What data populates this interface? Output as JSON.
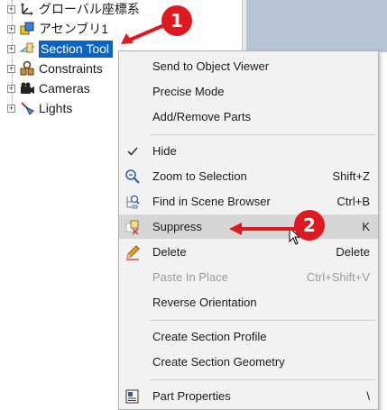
{
  "tree": {
    "items": [
      {
        "label": "グローバル座標系",
        "icon": "coordinate-system-icon"
      },
      {
        "label": "アセンブリ1",
        "icon": "assembly-icon"
      },
      {
        "label": "Section Tool",
        "icon": "section-tool-icon",
        "selected": true
      },
      {
        "label": "Constraints",
        "icon": "constraints-icon"
      },
      {
        "label": "Cameras",
        "icon": "cameras-icon"
      },
      {
        "label": "Lights",
        "icon": "lights-icon"
      }
    ]
  },
  "annotations": {
    "marker1": "1",
    "marker2": "2",
    "color": "#e0181f"
  },
  "context_menu": {
    "items": [
      {
        "label": "Send to Object Viewer",
        "shortcut": ""
      },
      {
        "label": "Precise Mode",
        "shortcut": ""
      },
      {
        "label": "Add/Remove Parts",
        "shortcut": ""
      },
      {
        "label": "Hide",
        "shortcut": "",
        "icon": "checkmark-icon"
      },
      {
        "label": "Zoom to Selection",
        "shortcut": "Shift+Z",
        "icon": "zoom-icon"
      },
      {
        "label": "Find in Scene Browser",
        "shortcut": "Ctrl+B",
        "icon": "find-in-browser-icon"
      },
      {
        "label": "Suppress",
        "shortcut": "K",
        "icon": "suppress-icon",
        "highlighted": true
      },
      {
        "label": "Delete",
        "shortcut": "Delete",
        "icon": "pencil-icon"
      },
      {
        "label": "Paste In Place",
        "shortcut": "Ctrl+Shift+V",
        "disabled": true
      },
      {
        "label": "Reverse Orientation",
        "shortcut": ""
      },
      {
        "label": "Create Section Profile",
        "shortcut": ""
      },
      {
        "label": "Create Section Geometry",
        "shortcut": ""
      },
      {
        "label": "Part Properties",
        "shortcut": "\\",
        "icon": "properties-icon"
      }
    ]
  },
  "colors": {
    "selection": "#0a64c8",
    "menu_background": "#f2f2f2",
    "highlight": "#d6d6d6",
    "viewport": "#b7c4d6"
  }
}
